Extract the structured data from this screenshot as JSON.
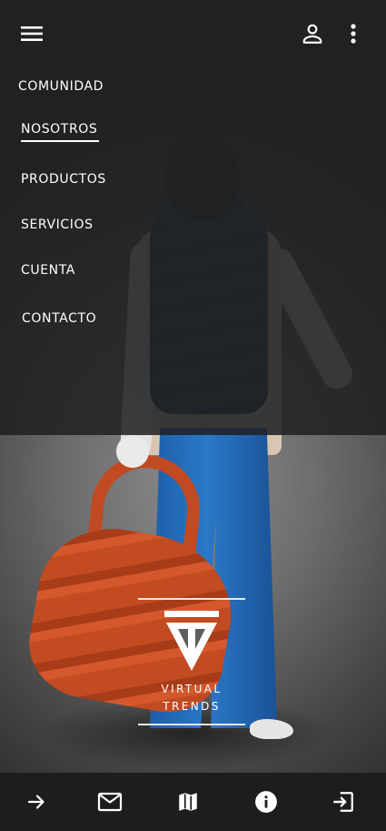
{
  "topbar": {
    "menu_icon": "hamburger-menu-icon",
    "account_icon": "person-outline-icon",
    "more_icon": "more-vertical-icon"
  },
  "nav": {
    "items": [
      {
        "label": "COMUNIDAD",
        "active": false
      },
      {
        "label": "NOSOTROS",
        "active": true
      },
      {
        "label": "PRODUCTOS",
        "active": false
      },
      {
        "label": "SERVICIOS",
        "active": false
      },
      {
        "label": "CUENTA",
        "active": false
      },
      {
        "label": "CONTACTO",
        "active": false
      }
    ]
  },
  "logo": {
    "line1": "VIRTUAL",
    "line2": "TRENDS"
  },
  "bottombar": {
    "icons": [
      "arrow-right-icon",
      "mail-icon",
      "map-icon",
      "info-icon",
      "exit-icon"
    ]
  },
  "colors": {
    "overlay": "#1e1f22",
    "bottombar": "#1c1d1f",
    "text": "#ffffff",
    "bag": "#c14a22",
    "pants": "#2a78c8"
  }
}
